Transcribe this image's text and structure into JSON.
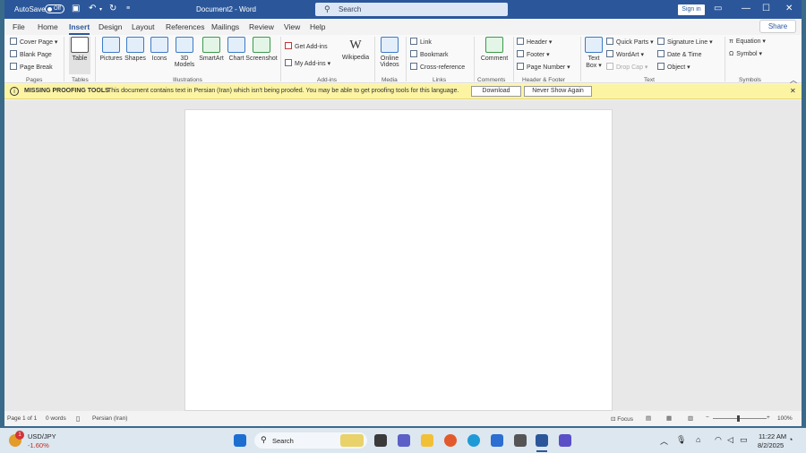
{
  "titlebar": {
    "autosave": "AutoSave",
    "toggle": "Off",
    "title": "Document2 - Word",
    "search": "Search",
    "signin": "Sign in"
  },
  "tabs": [
    "File",
    "Home",
    "Insert",
    "Design",
    "Layout",
    "References",
    "Mailings",
    "Review",
    "View",
    "Help"
  ],
  "share": "Share",
  "ribbon": {
    "pages": {
      "cover": "Cover Page",
      "blank": "Blank Page",
      "break": "Page Break",
      "label": "Pages"
    },
    "tables": {
      "table": "Table",
      "label": "Tables"
    },
    "illustrations": {
      "pictures": "Pictures",
      "shapes": "Shapes",
      "icons": "Icons",
      "models1": "3D",
      "models2": "Models",
      "smartart": "SmartArt",
      "chart": "Chart",
      "screenshot": "Screenshot",
      "label": "Illustrations"
    },
    "addins": {
      "get": "Get Add-ins",
      "my": "My Add-ins",
      "wikipedia": "Wikipedia",
      "label": "Add-ins"
    },
    "media": {
      "online1": "Online",
      "online2": "Videos",
      "label": "Media"
    },
    "links": {
      "link": "Link",
      "bookmark": "Bookmark",
      "crossref": "Cross-reference",
      "label": "Links"
    },
    "comments": {
      "comment": "Comment",
      "label": "Comments"
    },
    "hf": {
      "header": "Header",
      "footer": "Footer",
      "pagenum": "Page Number",
      "label": "Header & Footer"
    },
    "text": {
      "textbox1": "Text",
      "textbox2": "Box",
      "quickparts": "Quick Parts",
      "wordart": "WordArt",
      "dropcap": "Drop Cap",
      "sigline": "Signature Line",
      "datetime": "Date & Time",
      "object": "Object",
      "label": "Text"
    },
    "symbols": {
      "equation": "Equation",
      "symbol": "Symbol",
      "label": "Symbols"
    }
  },
  "message": {
    "title": "MISSING PROOFING TOOLS",
    "text": "This document contains text in Persian (Iran) which isn't being proofed. You may be able to get proofing tools for this language.",
    "download": "Download",
    "never": "Never Show Again"
  },
  "status": {
    "page": "Page 1 of 1",
    "words": "0 words",
    "lang": "Persian (Iran)",
    "focus": "Focus",
    "zoom": "100%"
  },
  "taskbar": {
    "ticker": "USD/JPY",
    "change": "-1.60%",
    "badge": "1",
    "search": "Search",
    "time": "11:22 AM",
    "date": "8/2/2025"
  },
  "colors": {
    "word_blue": "#2b579a",
    "message_bar": "#fcf4a3"
  }
}
